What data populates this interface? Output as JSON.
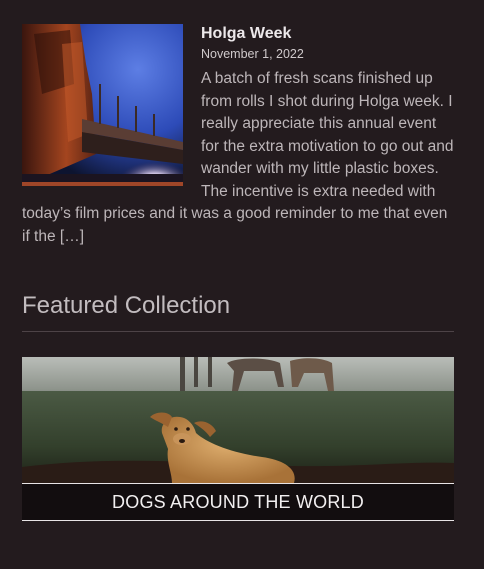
{
  "post": {
    "title": "Holga Week",
    "date": "November 1, 2022",
    "excerpt": "A batch of fresh scans finished up from rolls I shot during Holga week. I really appreciate this annual event for the extra motivation to go out and wander with my little plastic boxes. The incentive is extra needed with today’s film prices and it was a good reminder to me that even if the […]"
  },
  "featured": {
    "heading": "Featured Collection",
    "collection_title": "DOGS AROUND THE WORLD"
  }
}
